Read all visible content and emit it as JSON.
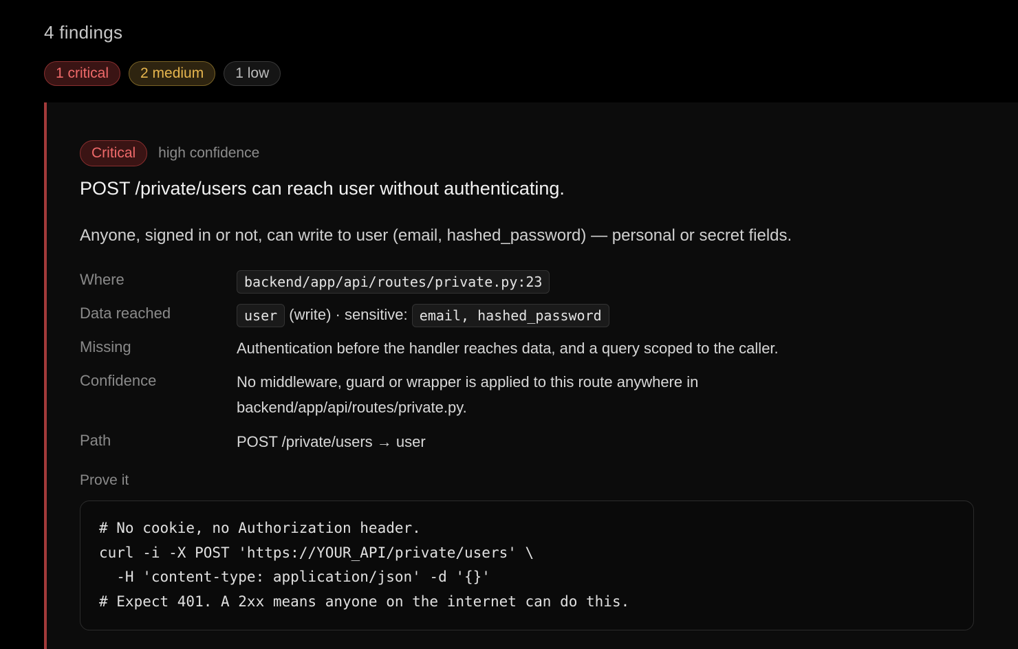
{
  "summary": {
    "title": "4 findings",
    "counts": {
      "critical": "1 critical",
      "medium": "2 medium",
      "low": "1 low"
    }
  },
  "finding": {
    "severity": "Critical",
    "confidence": "high confidence",
    "headline": "POST /private/users can reach user without authenticating.",
    "summary": "Anyone, signed in or not, can write to user (email, hashed_password) — personal or secret fields.",
    "details": {
      "where_label": "Where",
      "where_value": "backend/app/api/routes/private.py:23",
      "data_label": "Data reached",
      "data_table": "user",
      "data_mode": "(write) · sensitive:",
      "data_fields": "email, hashed_password",
      "missing_label": "Missing",
      "missing_value": "Authentication before the handler reaches data, and a query scoped to the caller.",
      "confidence_label": "Confidence",
      "confidence_line1": "No middleware, guard or wrapper is applied to this route anywhere in",
      "confidence_line2": "backend/app/api/routes/private.py.",
      "path_label": "Path",
      "path_value": "POST /private/users → user"
    },
    "prove": {
      "label": "Prove it",
      "lines": [
        "# No cookie, no Authorization header.",
        "curl -i -X POST 'https://YOUR_API/private/users' \\",
        "  -H 'content-type: application/json' -d '{}'",
        "# Expect 401. A 2xx means anyone on the internet can do this."
      ]
    }
  },
  "colors": {
    "critical": "#f06a6a",
    "medium": "#e7b64e",
    "low": "#bdbdbd",
    "accent_border": "#a33a3a"
  }
}
